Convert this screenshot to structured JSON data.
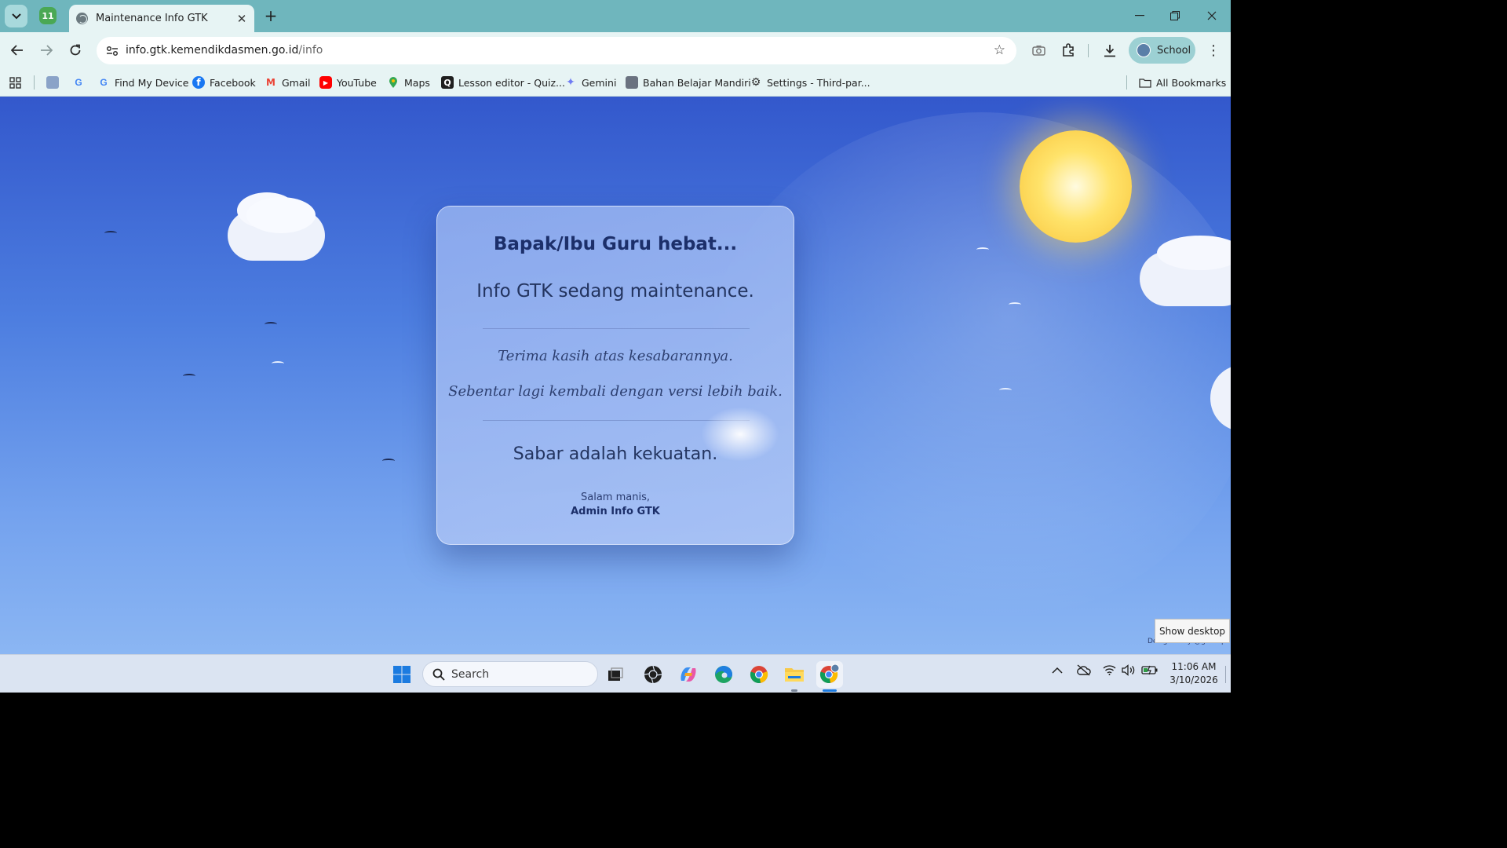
{
  "browser": {
    "tab_group_count": "11",
    "tab_title": "Maintenance Info GTK",
    "url_host": "info.gtk.kemendikdasmen.go.id",
    "url_path": "/info",
    "profile_label": "School",
    "bookmarks": [
      {
        "label": "",
        "icon": "apps-grid-icon"
      },
      {
        "label": "",
        "icon": "image-bookmark-icon"
      },
      {
        "label": "",
        "icon": "google-icon"
      },
      {
        "label": "Find My Device",
        "icon": "google-icon"
      },
      {
        "label": "Facebook",
        "icon": "facebook-icon"
      },
      {
        "label": "Gmail",
        "icon": "gmail-icon"
      },
      {
        "label": "YouTube",
        "icon": "youtube-icon"
      },
      {
        "label": "Maps",
        "icon": "maps-icon"
      },
      {
        "label": "Lesson editor - Quiz...",
        "icon": "quizizz-icon"
      },
      {
        "label": "Gemini",
        "icon": "gemini-icon"
      },
      {
        "label": "Bahan Belajar Mandiri",
        "icon": "document-icon"
      },
      {
        "label": "Settings - Third-par...",
        "icon": "gear-icon"
      }
    ],
    "all_bookmarks": "All Bookmarks"
  },
  "page": {
    "title": "Bapak/Ibu Guru hebat...",
    "subtitle": "Info GTK sedang maintenance.",
    "thanks": "Terima kasih atas kesabarannya.",
    "soon": "Sebentar lagi kembali dengan versi lebih baik.",
    "motto": "Sabar adalah kekuatan.",
    "salam": "Salam manis,",
    "admin": "Admin Info GTK",
    "credit": "Designed by @gtkutips"
  },
  "tooltip": "Show desktop",
  "taskbar": {
    "search_label": "Search",
    "time": "11:06 AM",
    "date": "3/10/2026"
  },
  "colors": {
    "chrome_titlebar": "#6fb6bd",
    "chrome_toolbar": "#e7f4f4",
    "sky_top": "#3358cc",
    "sky_bottom": "#8bb6f3",
    "sun": "#ffe36a",
    "card_title": "#1c2f6a"
  }
}
